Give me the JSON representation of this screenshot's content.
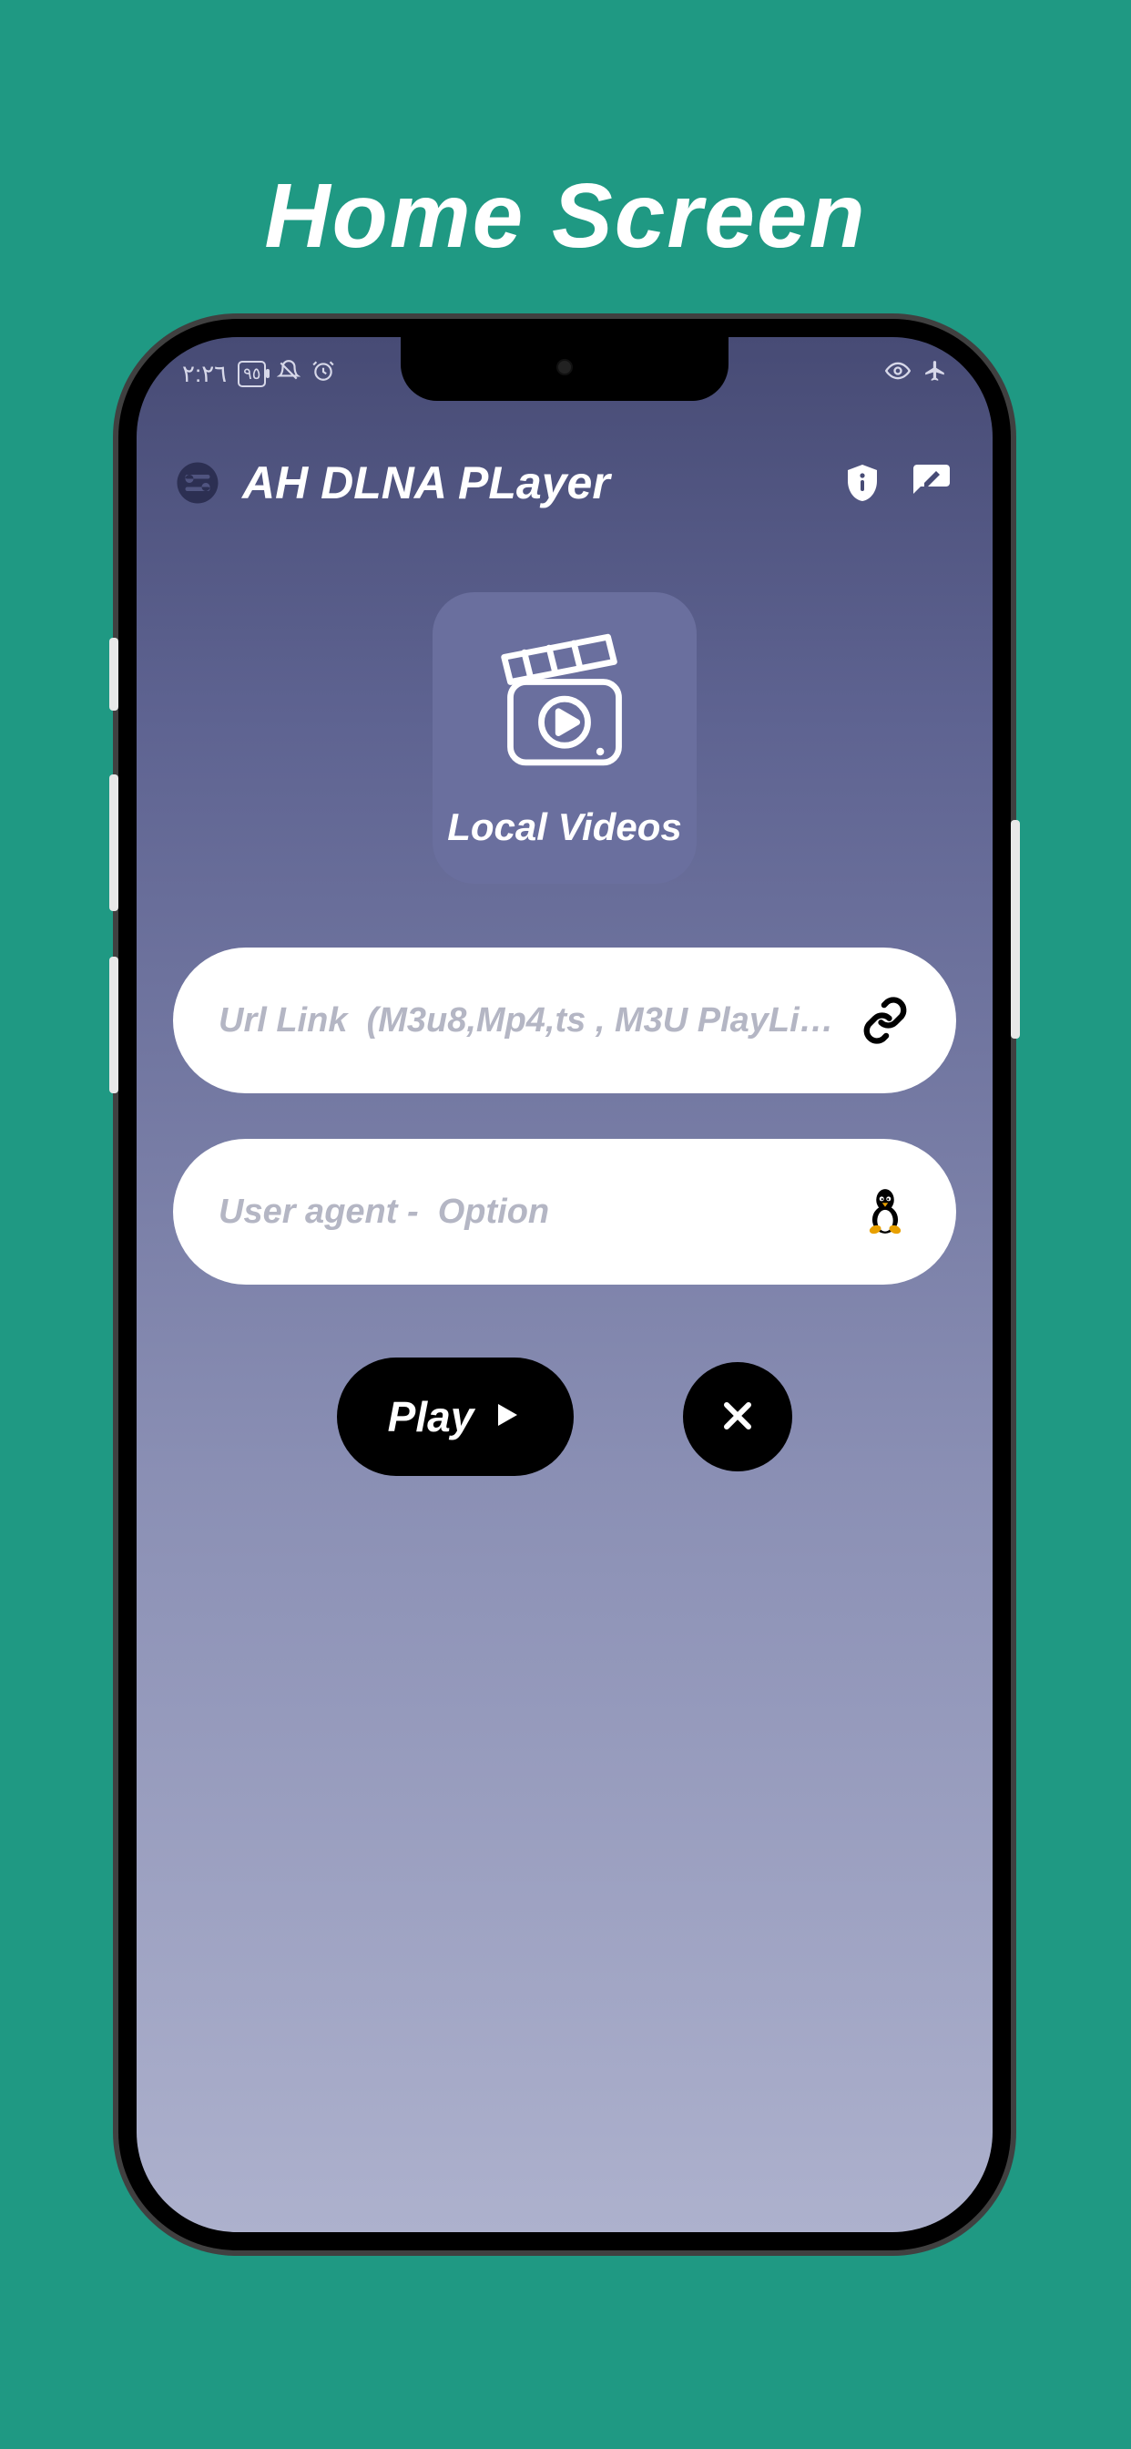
{
  "page": {
    "title": "Home Screen"
  },
  "status": {
    "time": "٢:٢٦",
    "battery_text": "٩٥"
  },
  "header": {
    "app_title": "AH DLNA PLayer"
  },
  "tile": {
    "local_videos_label": "Local Videos"
  },
  "inputs": {
    "url": {
      "placeholder": "Url Link  (M3u8,Mp4,ts , M3U PlayList ,All F...",
      "value": ""
    },
    "user_agent": {
      "placeholder": "User agent -  Option",
      "value": ""
    }
  },
  "actions": {
    "play_label": "Play"
  }
}
